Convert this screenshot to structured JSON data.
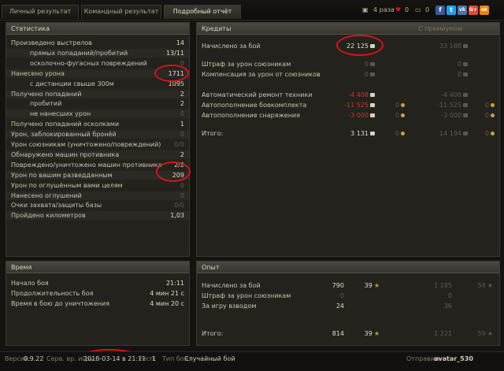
{
  "tabs": [
    "Личный результат",
    "Командный результат",
    "Подробный отчёт"
  ],
  "topbar": {
    "count": "4 раза",
    "likes": "0",
    "comments": "0",
    "social": [
      "f",
      "t",
      "vk",
      "G+",
      "ok"
    ]
  },
  "colors": {
    "highlight": "#d8141a",
    "negative": "#c33a2a",
    "gold": "#c9a23a"
  },
  "stats": {
    "title": "Статистика",
    "rows": [
      {
        "label": "Произведено выстрелов",
        "value": "14",
        "sub": false,
        "dim": false
      },
      {
        "label": "прямых попаданий/пробитий",
        "value": "13/11",
        "sub": true,
        "dim": false
      },
      {
        "label": "осколочно-фугасных повреждений",
        "value": "0",
        "sub": true,
        "dim": true
      },
      {
        "label": "Нанесено урона",
        "value": "1711",
        "sub": false,
        "dim": false
      },
      {
        "label": "с дистанции свыше 300м",
        "value": "1095",
        "sub": true,
        "dim": false
      },
      {
        "label": "Получено попаданий",
        "value": "2",
        "sub": false,
        "dim": false
      },
      {
        "label": "пробитий",
        "value": "2",
        "sub": true,
        "dim": false
      },
      {
        "label": "не нанесших урон",
        "value": "0",
        "sub": true,
        "dim": true
      },
      {
        "label": "Получено попаданий осколками",
        "value": "1",
        "sub": false,
        "dim": false
      },
      {
        "label": "Урон, заблокированный бронёй",
        "value": "0",
        "sub": false,
        "dim": true
      },
      {
        "label": "Урон союзникам (уничтожено/повреждений)",
        "value": "0/0",
        "sub": false,
        "dim": true
      },
      {
        "label": "Обнаружено машин противника",
        "value": "2",
        "sub": false,
        "dim": false
      },
      {
        "label": "Повреждено/уничтожено машин противника",
        "value": "2/2",
        "sub": false,
        "dim": false
      },
      {
        "label": "Урон по вашим разведданным",
        "value": "209",
        "sub": false,
        "dim": false
      },
      {
        "label": "Урон по оглушённым вами целям",
        "value": "0",
        "sub": false,
        "dim": true
      },
      {
        "label": "Нанесено оглушений",
        "value": "0",
        "sub": false,
        "dim": true
      },
      {
        "label": "Очки захвата/защиты базы",
        "value": "0/0",
        "sub": false,
        "dim": true
      },
      {
        "label": "Пройдено километров",
        "value": "1,03",
        "sub": false,
        "dim": false
      }
    ]
  },
  "credits": {
    "title": "Кредиты",
    "premium_label": "С премиумом",
    "rows": [
      {
        "label": "Начислено за бой",
        "value": "22 125",
        "prem": "33 188",
        "red": false,
        "dim": false,
        "gold": null,
        "gold_prem": null
      },
      {
        "label": "Штраф за урон союзникам",
        "value": "0",
        "prem": "0",
        "red": false,
        "dim": true,
        "gold": null,
        "gold_prem": null
      },
      {
        "label": "Компенсация за урон от союзников",
        "value": "0",
        "prem": "0",
        "red": false,
        "dim": true,
        "gold": null,
        "gold_prem": null
      },
      {
        "label": "Автоматический ремонт техники",
        "value": "-4 408",
        "prem": "-4 408",
        "red": true,
        "dim": false,
        "gold": null,
        "gold_prem": null
      },
      {
        "label": "Автопополнение боекомплекта",
        "value": "-11 525",
        "prem": "-11 525",
        "red": true,
        "dim": false,
        "gold": "0",
        "gold_prem": "0"
      },
      {
        "label": "Автопополнение снаряжения",
        "value": "-3 000",
        "prem": "-3 000",
        "red": true,
        "dim": false,
        "gold": "0",
        "gold_prem": "0"
      },
      {
        "label": "Итого:",
        "value": "3 131",
        "prem": "14 194",
        "red": false,
        "dim": false,
        "gold": "0",
        "gold_prem": "0"
      }
    ]
  },
  "time": {
    "title": "Время",
    "rows": [
      {
        "label": "Начало боя",
        "value": "21:11"
      },
      {
        "label": "Продолжительность боя",
        "value": "4 мин 21 с"
      },
      {
        "label": "Время в бою до уничтожения",
        "value": "4 мин 20 с"
      }
    ]
  },
  "experience": {
    "title": "Опыт",
    "rows": [
      {
        "label": "Начислено за бой",
        "value": "790",
        "free": "39",
        "prem": "1 185",
        "prem_free": "58"
      },
      {
        "label": "Штраф за урон союзникам",
        "value": "0",
        "free": null,
        "prem": "0",
        "prem_free": null
      },
      {
        "label": "За игру взводом",
        "value": "24",
        "free": null,
        "prem": "36",
        "prem_free": null
      },
      {
        "label": "Итого:",
        "value": "814",
        "free": "39",
        "prem": "1 221",
        "prem_free": "59"
      }
    ]
  },
  "footer": {
    "version_label": "Версия:",
    "version": "0.9.22",
    "server_label": "Серв. вр. игры:",
    "server_time": "2018-03-14 в 21:11",
    "resp_label": "Респ:",
    "resp": "1",
    "type_label": "Тип боя:",
    "type": "Случайный бой",
    "sender_label": "Отправил:",
    "sender": "avatar_530"
  }
}
